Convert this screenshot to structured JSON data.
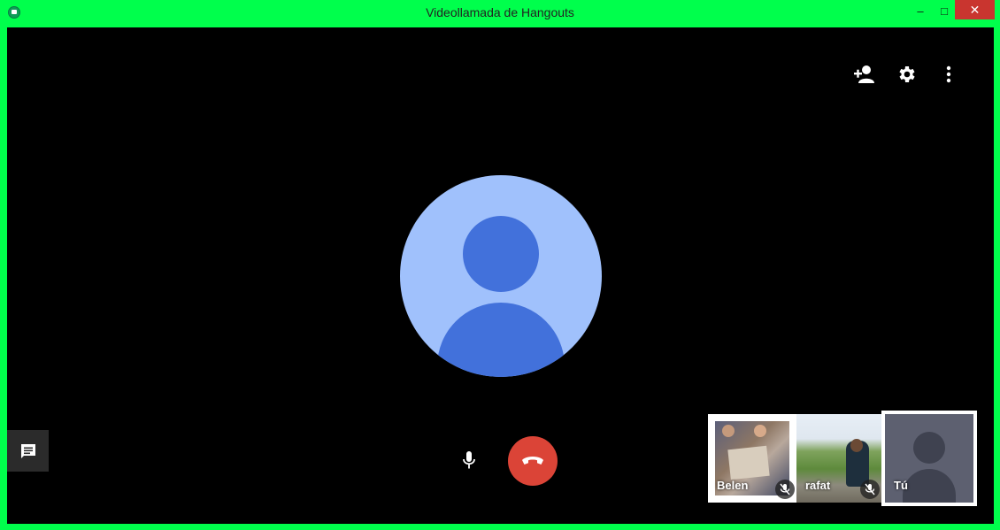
{
  "window": {
    "title": "Videollamada de Hangouts",
    "controls": {
      "minimize": "‒",
      "maximize": "□",
      "close": "✕"
    }
  },
  "toolbar": {
    "icons": [
      "add-person-icon",
      "gear-icon",
      "more-vert-icon"
    ]
  },
  "participants": [
    {
      "name": "Belen",
      "muted": true
    },
    {
      "name": "rafat",
      "muted": true
    },
    {
      "name": "Tú",
      "muted": false
    }
  ],
  "colors": {
    "frame": "#00ff4c",
    "hangup": "#db4437",
    "avatar_bg": "#a0c1fc",
    "avatar_fg": "#4271db",
    "stage": "#000000"
  }
}
